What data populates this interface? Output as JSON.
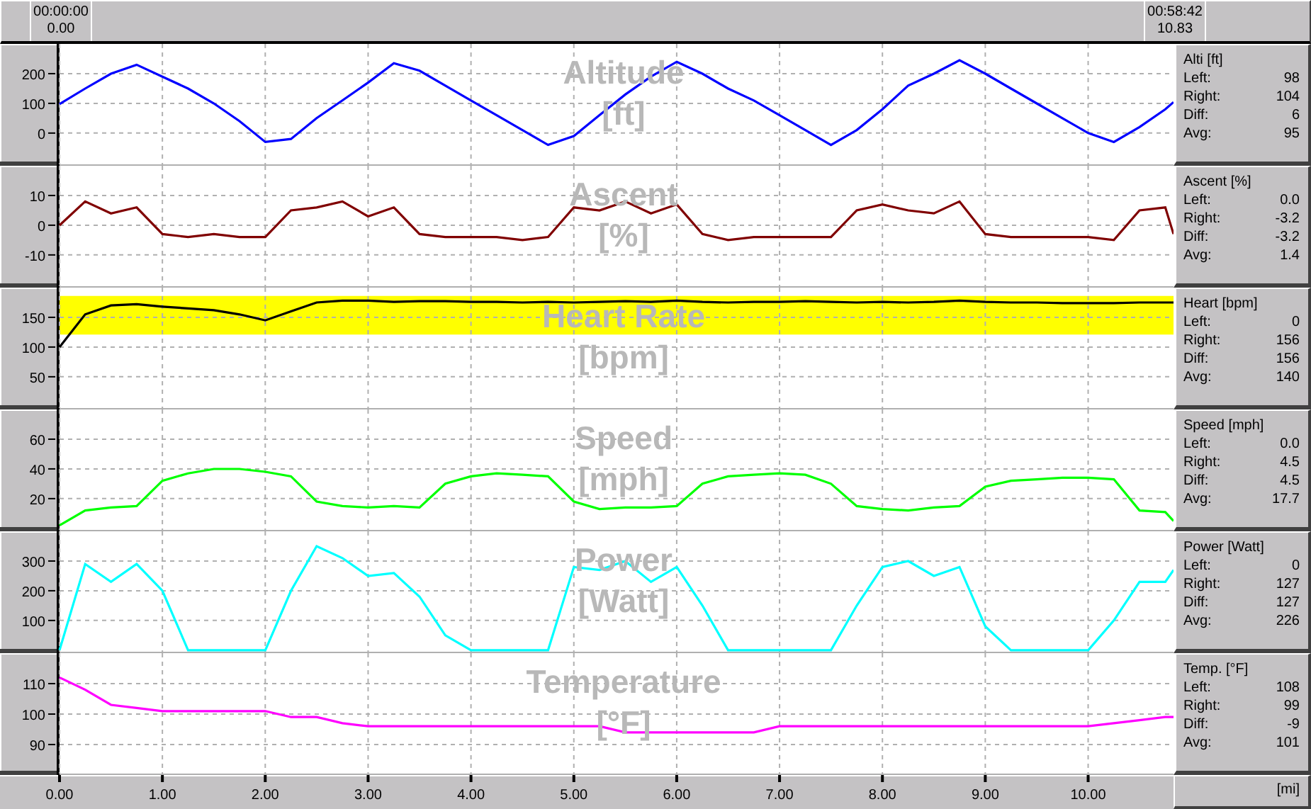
{
  "cursors": [
    {
      "time": "00:00:00",
      "distance": "0.00"
    },
    {
      "time": "00:58:42",
      "distance": "10.83"
    }
  ],
  "panels": [
    {
      "stats": {
        "title": "Alti [ft]",
        "rows": [
          {
            "label": "Left:",
            "value": "98"
          },
          {
            "label": "Right:",
            "value": "104"
          },
          {
            "label": "Diff:",
            "value": "6"
          },
          {
            "label": "Avg:",
            "value": "95"
          }
        ]
      },
      "chart_data": {
        "type": "line",
        "grid": true,
        "ylabel": "[ft]",
        "xlim": [
          0,
          10.83
        ],
        "ylim": [
          -110,
          300
        ],
        "yticks": [
          0,
          100,
          200
        ],
        "x": [
          0,
          0.25,
          0.5,
          0.75,
          1,
          1.25,
          1.5,
          1.75,
          2,
          2.25,
          2.5,
          2.75,
          3,
          3.25,
          3.5,
          3.75,
          4,
          4.25,
          4.5,
          4.75,
          5,
          5.25,
          5.5,
          5.75,
          6,
          6.25,
          6.5,
          6.75,
          7,
          7.25,
          7.5,
          7.75,
          8,
          8.25,
          8.5,
          8.75,
          9,
          9.25,
          9.5,
          9.75,
          10,
          10.25,
          10.5,
          10.75,
          10.83
        ],
        "series": [
          {
            "name": "Altitude",
            "color": "#0000ff",
            "values": [
              98,
              150,
              200,
              230,
              190,
              150,
              100,
              40,
              -30,
              -20,
              50,
              110,
              170,
              235,
              210,
              160,
              110,
              60,
              10,
              -40,
              -10,
              60,
              130,
              190,
              240,
              200,
              150,
              110,
              60,
              10,
              -40,
              10,
              80,
              160,
              200,
              245,
              200,
              150,
              100,
              50,
              0,
              -30,
              20,
              80,
              104
            ]
          }
        ]
      }
    },
    {
      "stats": {
        "title": "Ascent [%]",
        "rows": [
          {
            "label": "Left:",
            "value": "0.0"
          },
          {
            "label": "Right:",
            "value": "-3.2"
          },
          {
            "label": "Diff:",
            "value": "-3.2"
          },
          {
            "label": "Avg:",
            "value": "1.4"
          }
        ]
      },
      "chart_data": {
        "type": "line",
        "grid": true,
        "ylabel": "[%]",
        "xlim": [
          0,
          10.83
        ],
        "ylim": [
          -21,
          20
        ],
        "yticks": [
          -10,
          0,
          10
        ],
        "x": [
          0,
          0.25,
          0.5,
          0.75,
          1,
          1.25,
          1.5,
          1.75,
          2,
          2.25,
          2.5,
          2.75,
          3,
          3.25,
          3.5,
          3.75,
          4,
          4.25,
          4.5,
          4.75,
          5,
          5.25,
          5.5,
          5.75,
          6,
          6.25,
          6.5,
          6.75,
          7,
          7.25,
          7.5,
          7.75,
          8,
          8.25,
          8.5,
          8.75,
          9,
          9.25,
          9.5,
          9.75,
          10,
          10.25,
          10.5,
          10.75,
          10.83
        ],
        "series": [
          {
            "name": "Ascent",
            "color": "#800000",
            "values": [
              0,
              8,
              4,
              6,
              -3,
              -4,
              -3,
              -4,
              -4,
              5,
              6,
              8,
              3,
              6,
              -3,
              -4,
              -4,
              -4,
              -5,
              -4,
              6,
              5,
              8,
              4,
              7,
              -3,
              -5,
              -4,
              -4,
              -4,
              -4,
              5,
              7,
              5,
              4,
              8,
              -3,
              -4,
              -4,
              -4,
              -4,
              -5,
              5,
              6,
              -3
            ]
          }
        ]
      }
    },
    {
      "stats": {
        "title": "Heart [bpm]",
        "rows": [
          {
            "label": "Left:",
            "value": "0"
          },
          {
            "label": "Right:",
            "value": "156"
          },
          {
            "label": "Diff:",
            "value": "156"
          },
          {
            "label": "Avg:",
            "value": "140"
          }
        ]
      },
      "chart_data": {
        "type": "line",
        "grid": true,
        "ylabel": "[bpm]",
        "xlim": [
          0,
          10.83
        ],
        "ylim": [
          -5,
          200
        ],
        "yticks": [
          50,
          100,
          150
        ],
        "bands": [
          {
            "axis": "y",
            "from": 121,
            "to": 186,
            "color": "#ffff00"
          }
        ],
        "x": [
          0,
          0.25,
          0.5,
          0.75,
          1,
          1.25,
          1.5,
          1.75,
          2,
          2.25,
          2.5,
          2.75,
          3,
          3.25,
          3.5,
          3.75,
          4,
          4.25,
          4.5,
          4.75,
          5,
          5.25,
          5.5,
          5.75,
          6,
          6.25,
          6.5,
          6.75,
          7,
          7.25,
          7.5,
          7.75,
          8,
          8.25,
          8.5,
          8.75,
          9,
          9.25,
          9.5,
          9.75,
          10,
          10.25,
          10.5,
          10.75,
          10.83
        ],
        "series": [
          {
            "name": "Heart Rate",
            "color": "#000000",
            "values": [
              100,
              155,
              170,
              172,
              168,
              165,
              162,
              155,
              145,
              160,
              175,
              178,
              178,
              176,
              177,
              177,
              176,
              176,
              175,
              176,
              175,
              176,
              177,
              176,
              178,
              176,
              175,
              176,
              176,
              177,
              176,
              175,
              176,
              175,
              176,
              178,
              176,
              175,
              175,
              174,
              174,
              174,
              175,
              175,
              175
            ]
          }
        ]
      }
    },
    {
      "stats": {
        "title": "Speed [mph]",
        "rows": [
          {
            "label": "Left:",
            "value": "0.0"
          },
          {
            "label": "Right:",
            "value": "4.5"
          },
          {
            "label": "Diff:",
            "value": "4.5"
          },
          {
            "label": "Avg:",
            "value": "17.7"
          }
        ]
      },
      "chart_data": {
        "type": "line",
        "grid": true,
        "ylabel": "[mph]",
        "xlim": [
          0,
          10.83
        ],
        "ylim": [
          -2,
          80
        ],
        "yticks": [
          20,
          40,
          60
        ],
        "x": [
          0,
          0.25,
          0.5,
          0.75,
          1,
          1.25,
          1.5,
          1.75,
          2,
          2.25,
          2.5,
          2.75,
          3,
          3.25,
          3.5,
          3.75,
          4,
          4.25,
          4.5,
          4.75,
          5,
          5.25,
          5.5,
          5.75,
          6,
          6.25,
          6.5,
          6.75,
          7,
          7.25,
          7.5,
          7.75,
          8,
          8.25,
          8.5,
          8.75,
          9,
          9.25,
          9.5,
          9.75,
          10,
          10.25,
          10.5,
          10.75,
          10.83
        ],
        "series": [
          {
            "name": "Speed",
            "color": "#00ff00",
            "values": [
              2,
              12,
              14,
              15,
              32,
              37,
              40,
              40,
              38,
              35,
              18,
              15,
              14,
              15,
              14,
              30,
              35,
              37,
              36,
              35,
              18,
              13,
              14,
              14,
              15,
              30,
              35,
              36,
              37,
              36,
              30,
              15,
              13,
              12,
              14,
              15,
              28,
              32,
              33,
              34,
              34,
              33,
              12,
              11,
              5
            ]
          }
        ]
      }
    },
    {
      "stats": {
        "title": "Power [Watt]",
        "rows": [
          {
            "label": "Left:",
            "value": "0"
          },
          {
            "label": "Right:",
            "value": "127"
          },
          {
            "label": "Diff:",
            "value": "127"
          },
          {
            "label": "Avg:",
            "value": "226"
          }
        ]
      },
      "chart_data": {
        "type": "line",
        "grid": true,
        "ylabel": "[Watt]",
        "xlim": [
          0,
          10.83
        ],
        "ylim": [
          -10,
          400
        ],
        "yticks": [
          100,
          200,
          300
        ],
        "x": [
          0,
          0.25,
          0.5,
          0.75,
          1,
          1.25,
          1.5,
          1.75,
          2,
          2.25,
          2.5,
          2.75,
          3,
          3.25,
          3.5,
          3.75,
          4,
          4.25,
          4.5,
          4.75,
          5,
          5.25,
          5.5,
          5.75,
          6,
          6.25,
          6.5,
          6.75,
          7,
          7.25,
          7.5,
          7.75,
          8,
          8.25,
          8.5,
          8.75,
          9,
          9.25,
          9.5,
          9.75,
          10,
          10.25,
          10.5,
          10.75,
          10.83
        ],
        "series": [
          {
            "name": "Power",
            "color": "#00ffff",
            "values": [
              0,
              290,
              230,
              290,
              200,
              0,
              0,
              0,
              0,
              200,
              350,
              310,
              250,
              260,
              180,
              50,
              0,
              0,
              0,
              0,
              280,
              270,
              300,
              230,
              280,
              150,
              0,
              0,
              0,
              0,
              0,
              150,
              280,
              300,
              250,
              280,
              80,
              0,
              0,
              0,
              0,
              100,
              230,
              230,
              270
            ]
          }
        ]
      }
    },
    {
      "stats": {
        "title": "Temp. [°F]",
        "rows": [
          {
            "label": "Left:",
            "value": "108"
          },
          {
            "label": "Right:",
            "value": "99"
          },
          {
            "label": "Diff:",
            "value": "-9"
          },
          {
            "label": "Avg:",
            "value": "101"
          }
        ]
      },
      "chart_data": {
        "type": "line",
        "grid": true,
        "ylabel": "[°F]",
        "xlim": [
          0,
          10.83
        ],
        "ylim": [
          80,
          120
        ],
        "yticks": [
          90,
          100,
          110
        ],
        "xticks": [
          {
            "value": 0,
            "label": "0.00"
          },
          {
            "value": 1,
            "label": "1.00"
          },
          {
            "value": 2,
            "label": "2.00"
          },
          {
            "value": 3,
            "label": "3.00"
          },
          {
            "value": 4,
            "label": "4.00"
          },
          {
            "value": 5,
            "label": "5.00"
          },
          {
            "value": 6,
            "label": "6.00"
          },
          {
            "value": 7,
            "label": "7.00"
          },
          {
            "value": 8,
            "label": "8.00"
          },
          {
            "value": 9,
            "label": "9.00"
          },
          {
            "value": 10,
            "label": "10.00"
          }
        ],
        "x": [
          0,
          0.25,
          0.5,
          0.75,
          1,
          1.25,
          1.5,
          1.75,
          2,
          2.25,
          2.5,
          2.75,
          3,
          3.25,
          3.5,
          3.75,
          4,
          4.25,
          4.5,
          4.75,
          5,
          5.25,
          5.5,
          5.75,
          6,
          6.25,
          6.5,
          6.75,
          7,
          7.25,
          7.5,
          7.75,
          8,
          8.25,
          8.5,
          8.75,
          9,
          9.25,
          9.5,
          9.75,
          10,
          10.25,
          10.5,
          10.75,
          10.83
        ],
        "series": [
          {
            "name": "Temperature",
            "color": "#ff00ff",
            "values": [
              112,
              108,
              103,
              102,
              101,
              101,
              101,
              101,
              101,
              99,
              99,
              97,
              96,
              96,
              96,
              96,
              96,
              96,
              96,
              96,
              96,
              96,
              94,
              94,
              94,
              94,
              94,
              94,
              96,
              96,
              96,
              96,
              96,
              96,
              96,
              96,
              96,
              96,
              96,
              96,
              96,
              97,
              98,
              99,
              99
            ]
          }
        ]
      }
    }
  ],
  "x_unit": "[mi]"
}
